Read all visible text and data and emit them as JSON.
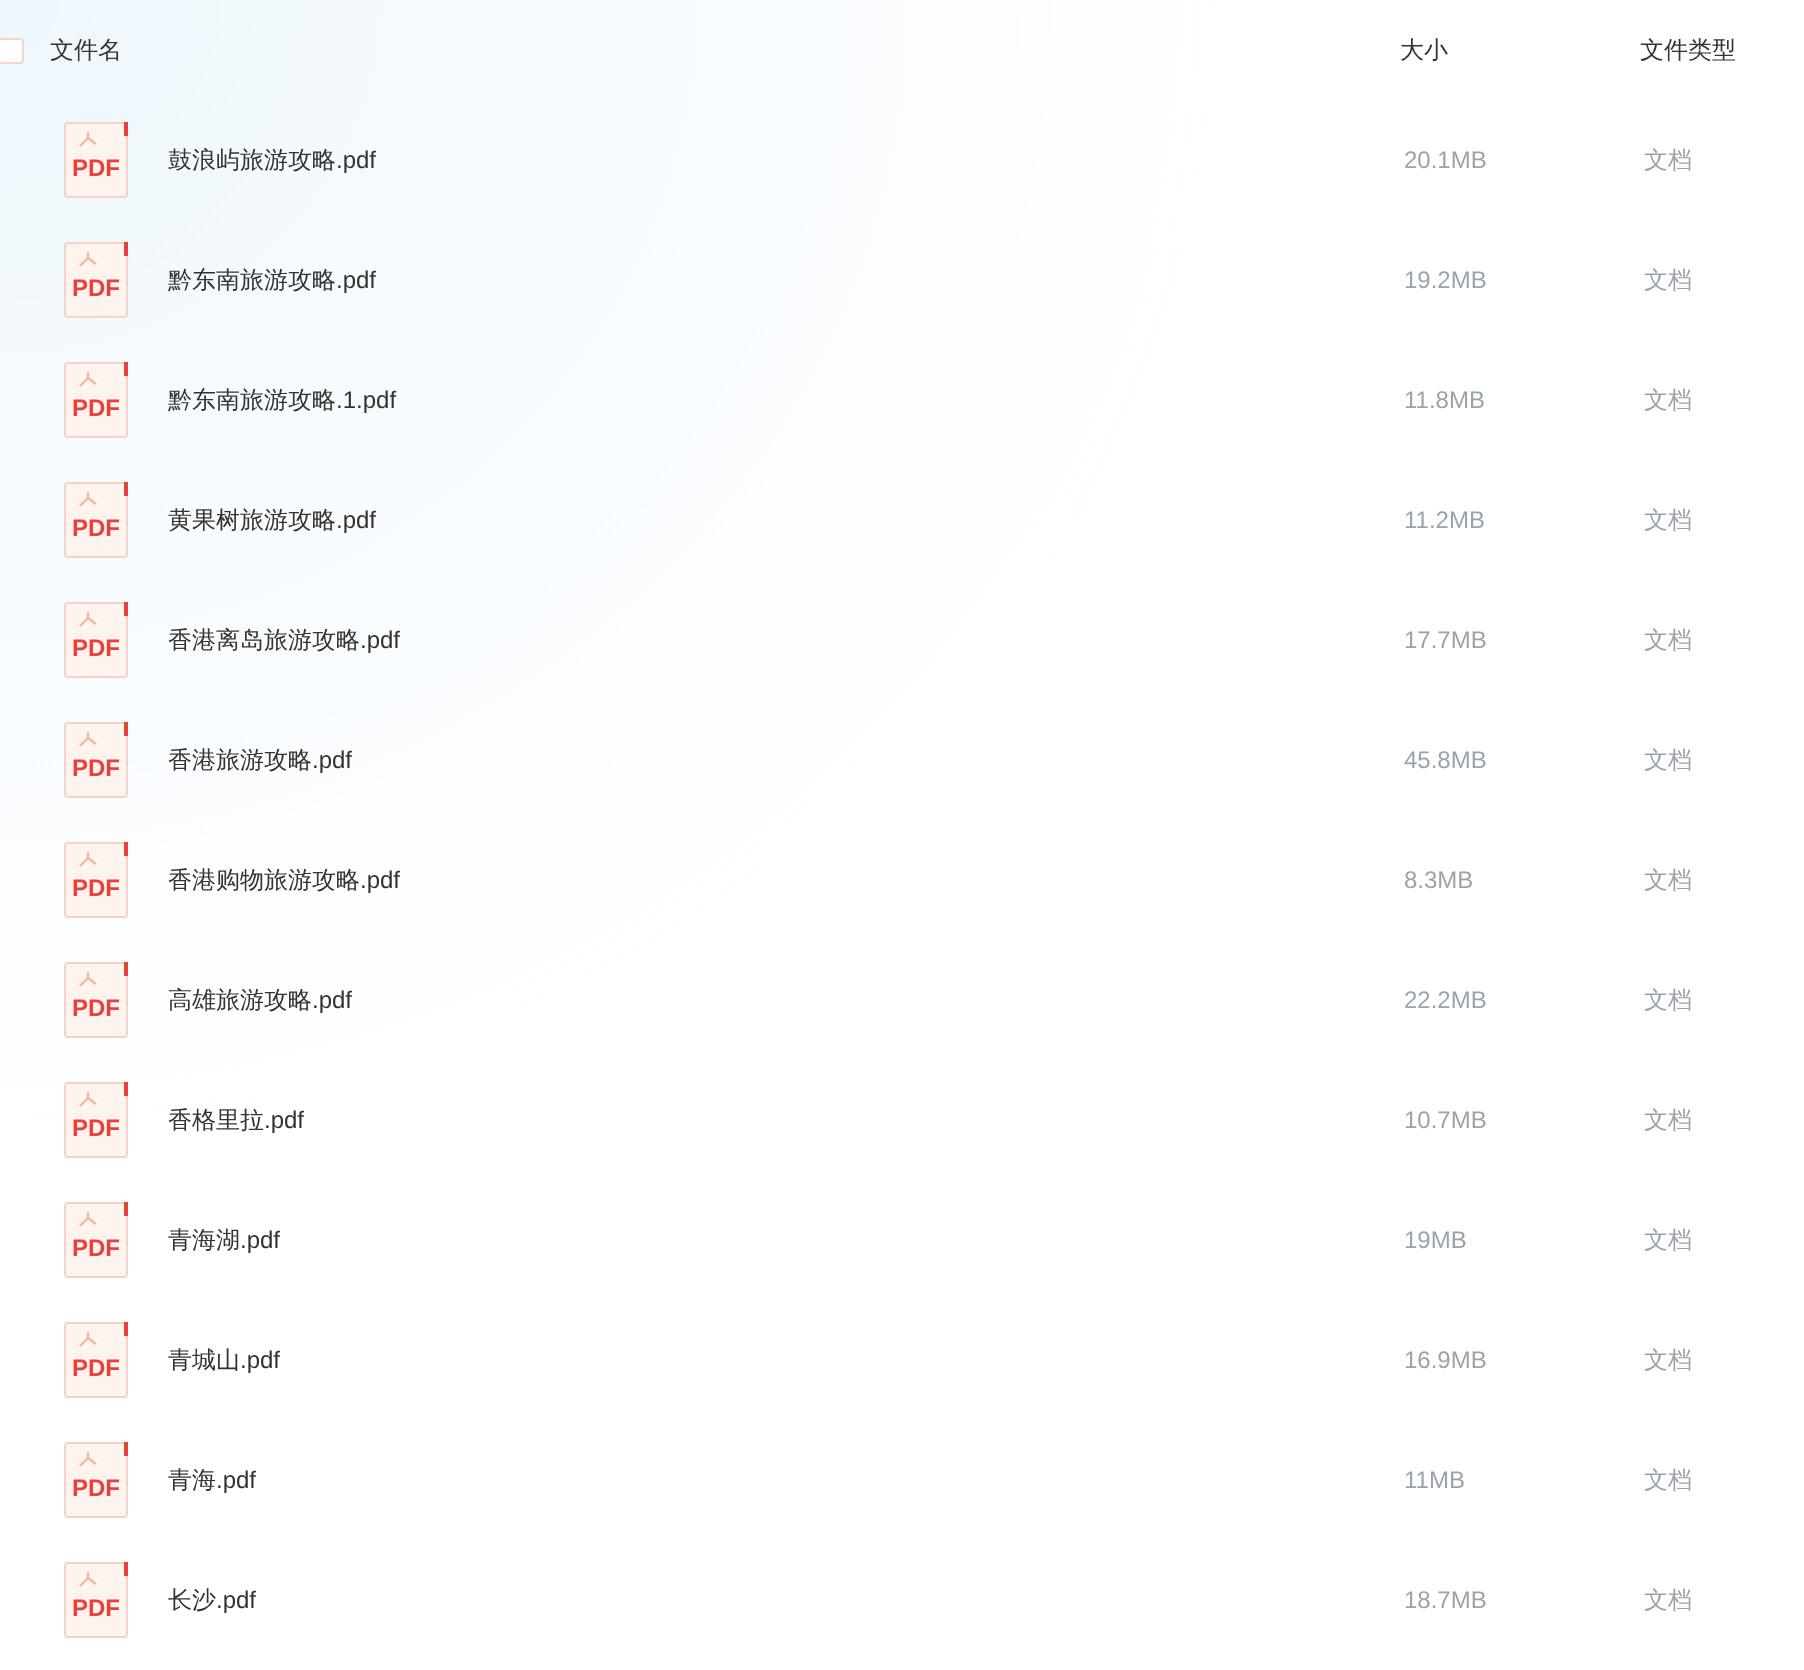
{
  "header": {
    "select_all": {
      "checked": false
    },
    "columns": [
      "文件名",
      "大小",
      "文件类型"
    ]
  },
  "rows": [
    {
      "icon_text": "PDF",
      "name": "鼓浪屿旅游攻略.pdf",
      "size": "20.1MB",
      "type": "文档"
    },
    {
      "icon_text": "PDF",
      "name": "黔东南旅游攻略.pdf",
      "size": "19.2MB",
      "type": "文档"
    },
    {
      "icon_text": "PDF",
      "name": "黔东南旅游攻略.1.pdf",
      "size": "11.8MB",
      "type": "文档"
    },
    {
      "icon_text": "PDF",
      "name": "黄果树旅游攻略.pdf",
      "size": "11.2MB",
      "type": "文档"
    },
    {
      "icon_text": "PDF",
      "name": "香港离岛旅游攻略.pdf",
      "size": "17.7MB",
      "type": "文档"
    },
    {
      "icon_text": "PDF",
      "name": "香港旅游攻略.pdf",
      "size": "45.8MB",
      "type": "文档"
    },
    {
      "icon_text": "PDF",
      "name": "香港购物旅游攻略.pdf",
      "size": "8.3MB",
      "type": "文档"
    },
    {
      "icon_text": "PDF",
      "name": "高雄旅游攻略.pdf",
      "size": "22.2MB",
      "type": "文档"
    },
    {
      "icon_text": "PDF",
      "name": "香格里拉.pdf",
      "size": "10.7MB",
      "type": "文档"
    },
    {
      "icon_text": "PDF",
      "name": "青海湖.pdf",
      "size": "19MB",
      "type": "文档"
    },
    {
      "icon_text": "PDF",
      "name": "青城山.pdf",
      "size": "16.9MB",
      "type": "文档"
    },
    {
      "icon_text": "PDF",
      "name": "青海.pdf",
      "size": "11MB",
      "type": "文档"
    },
    {
      "icon_text": "PDF",
      "name": "长沙.pdf",
      "size": "18.7MB",
      "type": "文档"
    }
  ]
}
